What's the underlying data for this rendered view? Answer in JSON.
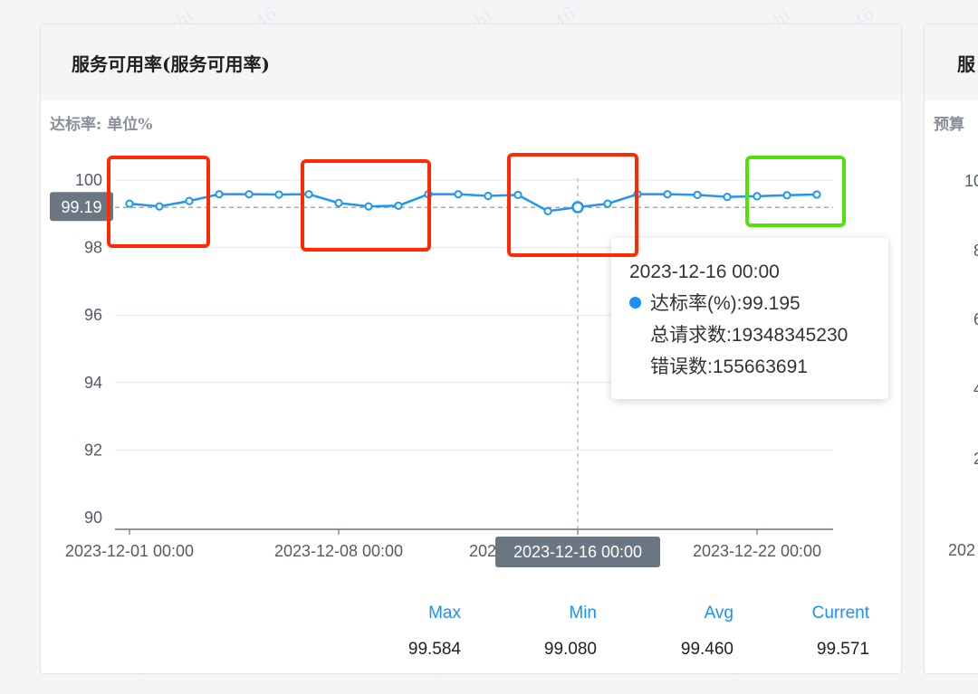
{
  "main_card": {
    "title": "服务可用率(服务可用率)",
    "subtitle": "达标率: 单位%"
  },
  "side_card": {
    "title": "服",
    "subtitle": "预算",
    "y_ticks": [
      "10",
      "8",
      "6",
      "4",
      "2"
    ],
    "x_tick": "202"
  },
  "chart_data": {
    "type": "line",
    "title": "",
    "ylabel": "达标率: 单位%",
    "xlabel": "",
    "ylim": [
      90,
      100
    ],
    "y_ticks": [
      "100",
      "98",
      "96",
      "94",
      "92",
      "90"
    ],
    "x_tick_labels": [
      "2023-12-01 00:00",
      "2023-12-08 00:00",
      "2023-12-16 00:00",
      "2023-12-22 00:00"
    ],
    "series": [
      {
        "name": "达标率(%)",
        "color": "#2196f3",
        "x": [
          "2023-12-01",
          "2023-12-02",
          "2023-12-03",
          "2023-12-04",
          "2023-12-05",
          "2023-12-06",
          "2023-12-07",
          "2023-12-08",
          "2023-12-09",
          "2023-12-10",
          "2023-12-11",
          "2023-12-12",
          "2023-12-13",
          "2023-12-14",
          "2023-12-15",
          "2023-12-16",
          "2023-12-17",
          "2023-12-18",
          "2023-12-19",
          "2023-12-20",
          "2023-12-21",
          "2023-12-22",
          "2023-12-23",
          "2023-12-24"
        ],
        "values": [
          99.3,
          99.22,
          99.38,
          99.58,
          99.58,
          99.57,
          99.58,
          99.32,
          99.22,
          99.24,
          99.58,
          99.58,
          99.53,
          99.56,
          99.08,
          99.195,
          99.3,
          99.58,
          99.58,
          99.56,
          99.5,
          99.52,
          99.55,
          99.571
        ]
      }
    ],
    "reference_line": {
      "value": 99.19,
      "label": "99.19"
    },
    "crosshair_x_label": "2023-12-16 00:00",
    "tooltip": {
      "title": "2023-12-16 00:00",
      "lines": [
        "达标率(%):99.195",
        "总请求数:19348345230",
        "错误数:155663691"
      ]
    },
    "stats": [
      {
        "label": "Max",
        "value": "99.584"
      },
      {
        "label": "Min",
        "value": "99.080"
      },
      {
        "label": "Avg",
        "value": "99.460"
      },
      {
        "label": "Current",
        "value": "99.571"
      }
    ]
  },
  "watermark": [
    "caishangzhi",
    "2023/12/25 10:41:46"
  ],
  "highlight_colors": {
    "red": "#ff2a00",
    "green": "#52e00d"
  }
}
